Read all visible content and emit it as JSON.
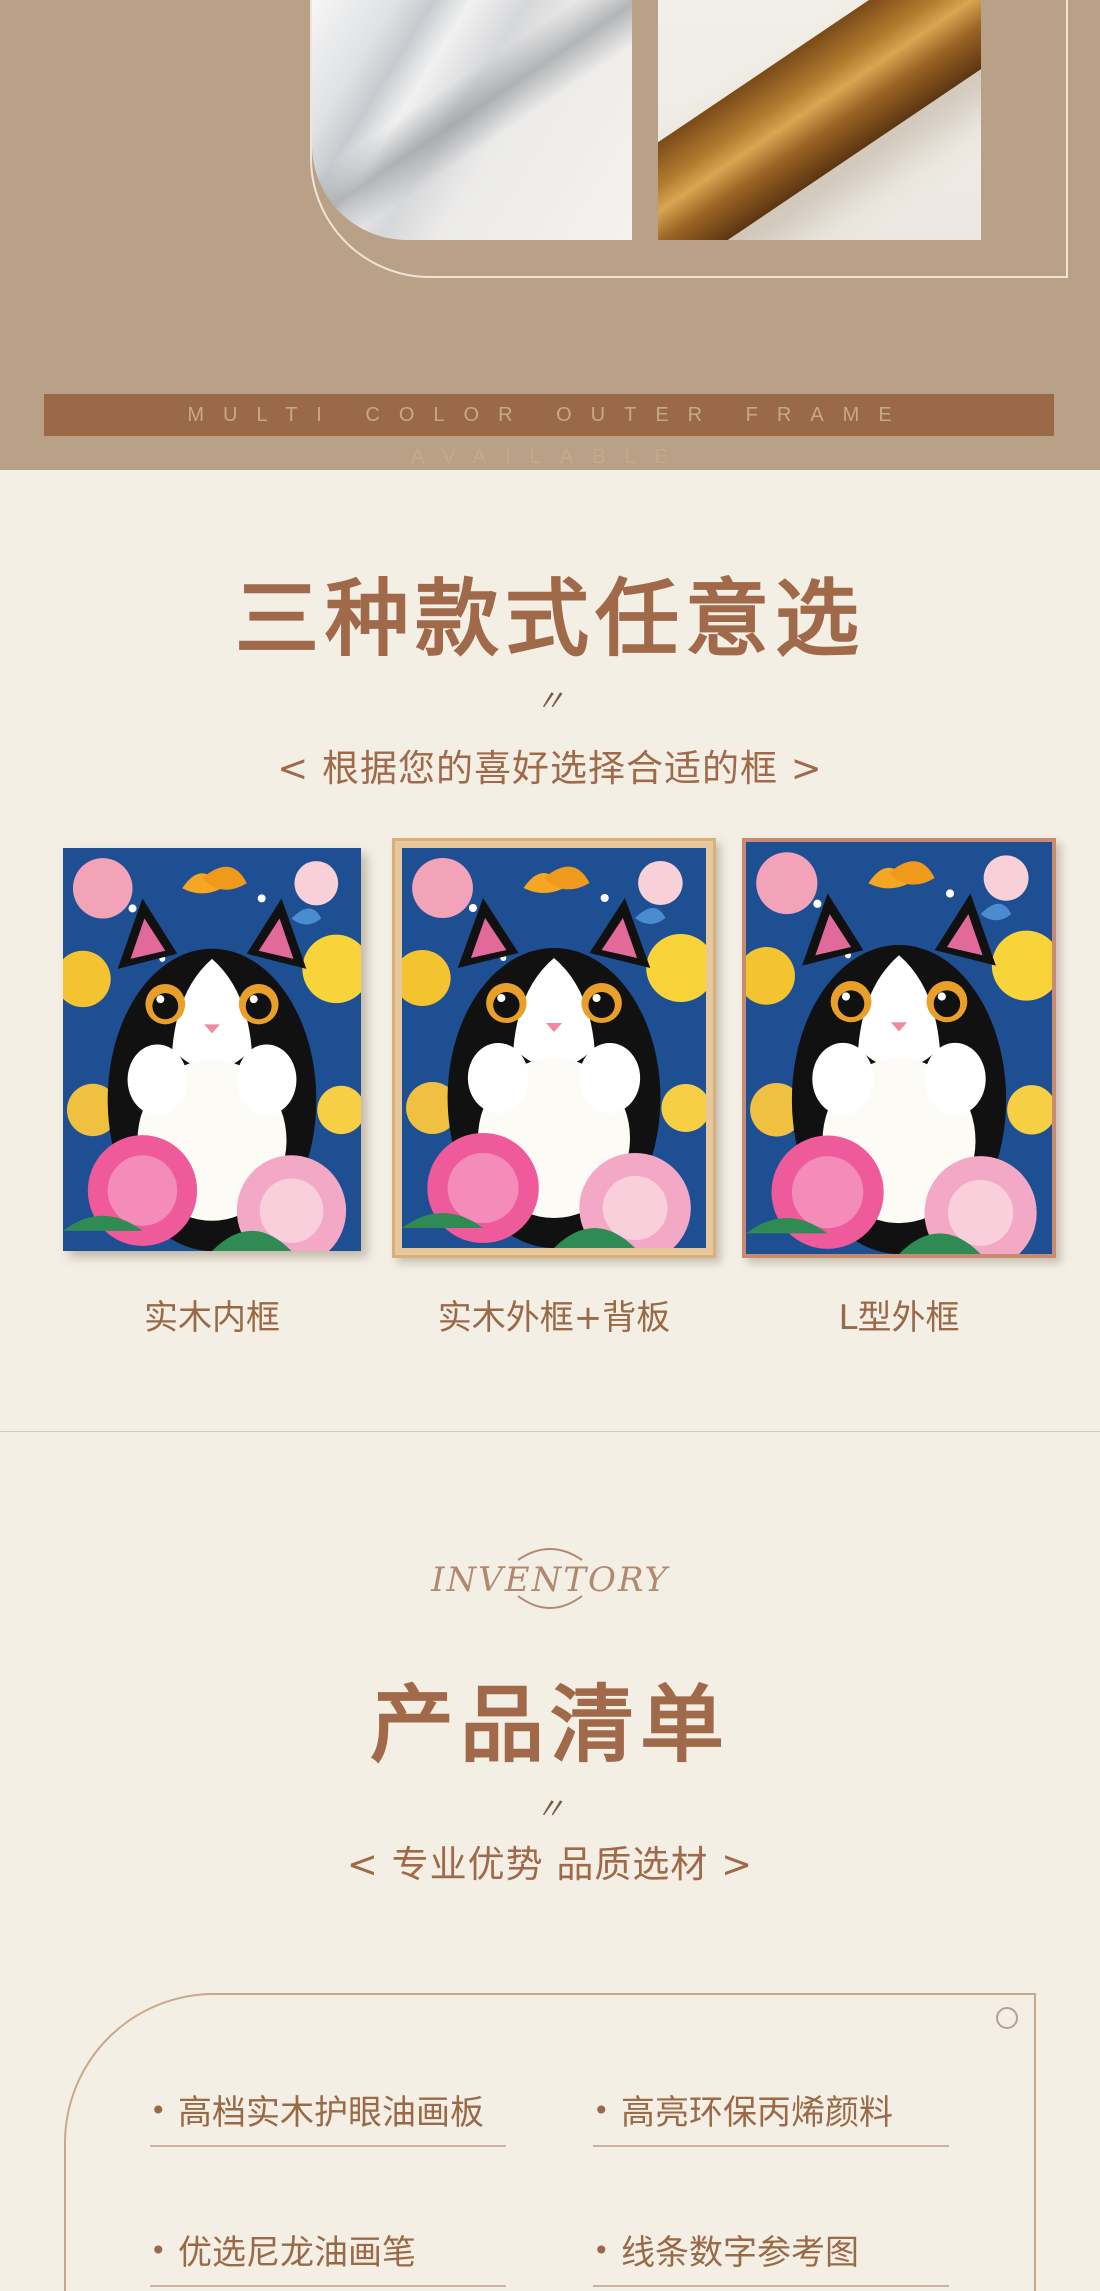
{
  "banner": {
    "text": "MULTI COLOR OUTER FRAME AVAILABLE"
  },
  "styles_section": {
    "title": "三种款式任意选",
    "quote": "〃",
    "subtitle": "< 根据您的喜好选择合适的框 >",
    "frames": [
      {
        "label": "实木内框"
      },
      {
        "label": "实木外框+背板"
      },
      {
        "label": "L型外框"
      }
    ]
  },
  "inventory_section": {
    "logo_text": "INVENTORY",
    "title": "产品清单",
    "quote": "〃",
    "subtitle": "< 专业优势 品质选材 >",
    "items": [
      {
        "label": "高档实木护眼油画板"
      },
      {
        "label": "高亮环保丙烯颜料"
      },
      {
        "label": "优选尼龙油画笔"
      },
      {
        "label": "线条数字参考图"
      }
    ]
  },
  "colors": {
    "accent": "#9a6a48",
    "background": "#f4efe4",
    "top_band": "#b9a188"
  }
}
